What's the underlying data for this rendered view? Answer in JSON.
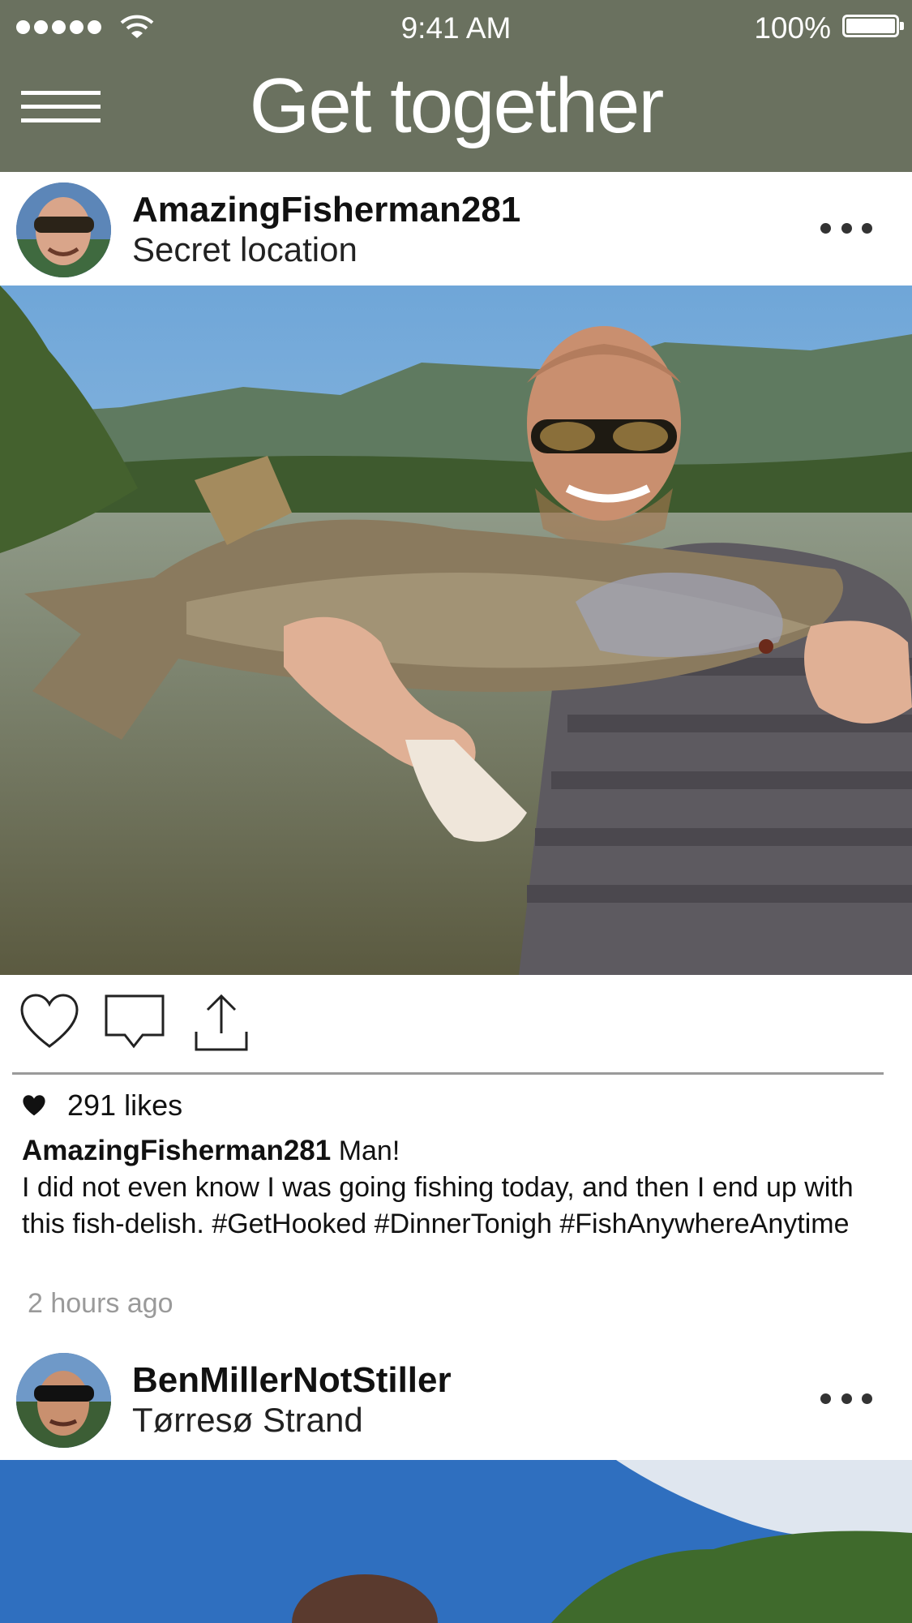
{
  "status_bar": {
    "time": "9:41 AM",
    "battery": "100%"
  },
  "header": {
    "title": "Get together",
    "menu_icon": "hamburger-icon"
  },
  "posts": [
    {
      "username": "AmazingFisherman281",
      "location": "Secret location",
      "likes": "291 likes",
      "caption_user": "AmazingFisherman281",
      "caption_lead": "Man!",
      "caption_body": "I did not even know I was going fishing today, and then I end up with this fish-delish. #GetHooked #DinnerTonigh #FishAnywhereAnytime",
      "time_ago": "2 hours ago"
    },
    {
      "username": "BenMillerNotStiller",
      "location": "Tørresø Strand"
    }
  ],
  "actions": [
    "heart-icon",
    "comment-icon",
    "share-icon"
  ],
  "colors": {
    "header_bg": "#6a715f",
    "divider": "#9a9a9a",
    "muted_text": "#9a9a9a"
  }
}
